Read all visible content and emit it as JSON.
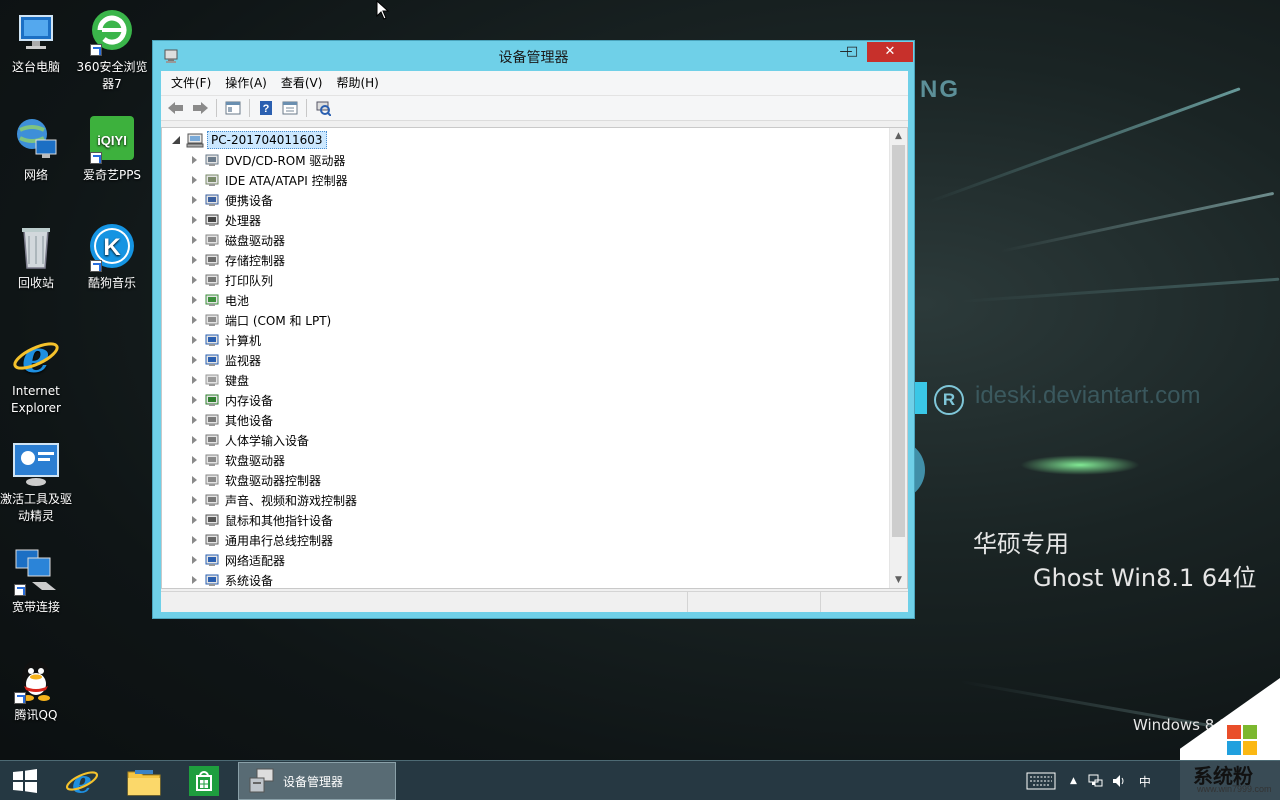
{
  "desktop": {
    "icons": [
      {
        "label": "这台电脑",
        "icon": "this-pc-icon"
      },
      {
        "label": "360安全浏览器7",
        "icon": "360-browser-icon"
      },
      {
        "label": "网络",
        "icon": "network-icon"
      },
      {
        "label": "爱奇艺PPS",
        "icon": "iqiyi-icon"
      },
      {
        "label": "回收站",
        "icon": "recycle-bin-icon"
      },
      {
        "label": "酷狗音乐",
        "icon": "kugou-icon"
      },
      {
        "label": "Internet Explorer",
        "icon": "ie-icon"
      },
      {
        "label": "激活工具及驱动精灵",
        "icon": "activation-tool-icon"
      },
      {
        "label": "宽带连接",
        "icon": "broadband-icon"
      },
      {
        "label": "腾讯QQ",
        "icon": "qq-icon"
      }
    ],
    "wallpaper_text": {
      "line1": "华硕专用",
      "line2": "Ghost Win8.1 64位",
      "windows": "Windows 8.1",
      "partial_logo": "NG",
      "deviant": "ideski.deviantart.com",
      "reg": "R"
    },
    "site_logo": {
      "text": "系统粉",
      "url": "www.win7999.com"
    }
  },
  "window": {
    "title": "设备管理器",
    "controls": {
      "minimize": "—",
      "maximize": "□",
      "close": "✕"
    },
    "menu": [
      "文件(F)",
      "操作(A)",
      "查看(V)",
      "帮助(H)"
    ],
    "toolbar": [
      "back-icon",
      "forward-icon",
      "properties-icon",
      "help-icon",
      "view-icon",
      "scan-hardware-icon"
    ],
    "tree": {
      "root": "PC-201704011603",
      "items": [
        {
          "label": "DVD/CD-ROM 驱动器",
          "icon": "dvd-drive-icon"
        },
        {
          "label": "IDE ATA/ATAPI 控制器",
          "icon": "ide-controller-icon"
        },
        {
          "label": "便携设备",
          "icon": "portable-device-icon"
        },
        {
          "label": "处理器",
          "icon": "processor-icon"
        },
        {
          "label": "磁盘驱动器",
          "icon": "disk-drive-icon"
        },
        {
          "label": "存储控制器",
          "icon": "storage-controller-icon"
        },
        {
          "label": "打印队列",
          "icon": "printer-icon"
        },
        {
          "label": "电池",
          "icon": "battery-icon"
        },
        {
          "label": "端口 (COM 和 LPT)",
          "icon": "port-icon"
        },
        {
          "label": "计算机",
          "icon": "computer-icon"
        },
        {
          "label": "监视器",
          "icon": "monitor-icon"
        },
        {
          "label": "键盘",
          "icon": "keyboard-icon"
        },
        {
          "label": "内存设备",
          "icon": "memory-icon"
        },
        {
          "label": "其他设备",
          "icon": "other-device-icon"
        },
        {
          "label": "人体学输入设备",
          "icon": "hid-icon"
        },
        {
          "label": "软盘驱动器",
          "icon": "floppy-drive-icon"
        },
        {
          "label": "软盘驱动器控制器",
          "icon": "floppy-controller-icon"
        },
        {
          "label": "声音、视频和游戏控制器",
          "icon": "sound-icon"
        },
        {
          "label": "鼠标和其他指针设备",
          "icon": "mouse-icon"
        },
        {
          "label": "通用串行总线控制器",
          "icon": "usb-icon"
        },
        {
          "label": "网络适配器",
          "icon": "network-adapter-icon"
        },
        {
          "label": "系统设备",
          "icon": "system-device-icon"
        }
      ]
    }
  },
  "taskbar": {
    "pinned": [
      "start-icon",
      "ie-icon",
      "file-explorer-icon",
      "store-icon"
    ],
    "active_task": "设备管理器",
    "tray": {
      "ime": "中"
    }
  },
  "colors": {
    "window_frame": "#6fd0e8",
    "close_button": "#c7302b",
    "selection": "#cce8ff"
  }
}
